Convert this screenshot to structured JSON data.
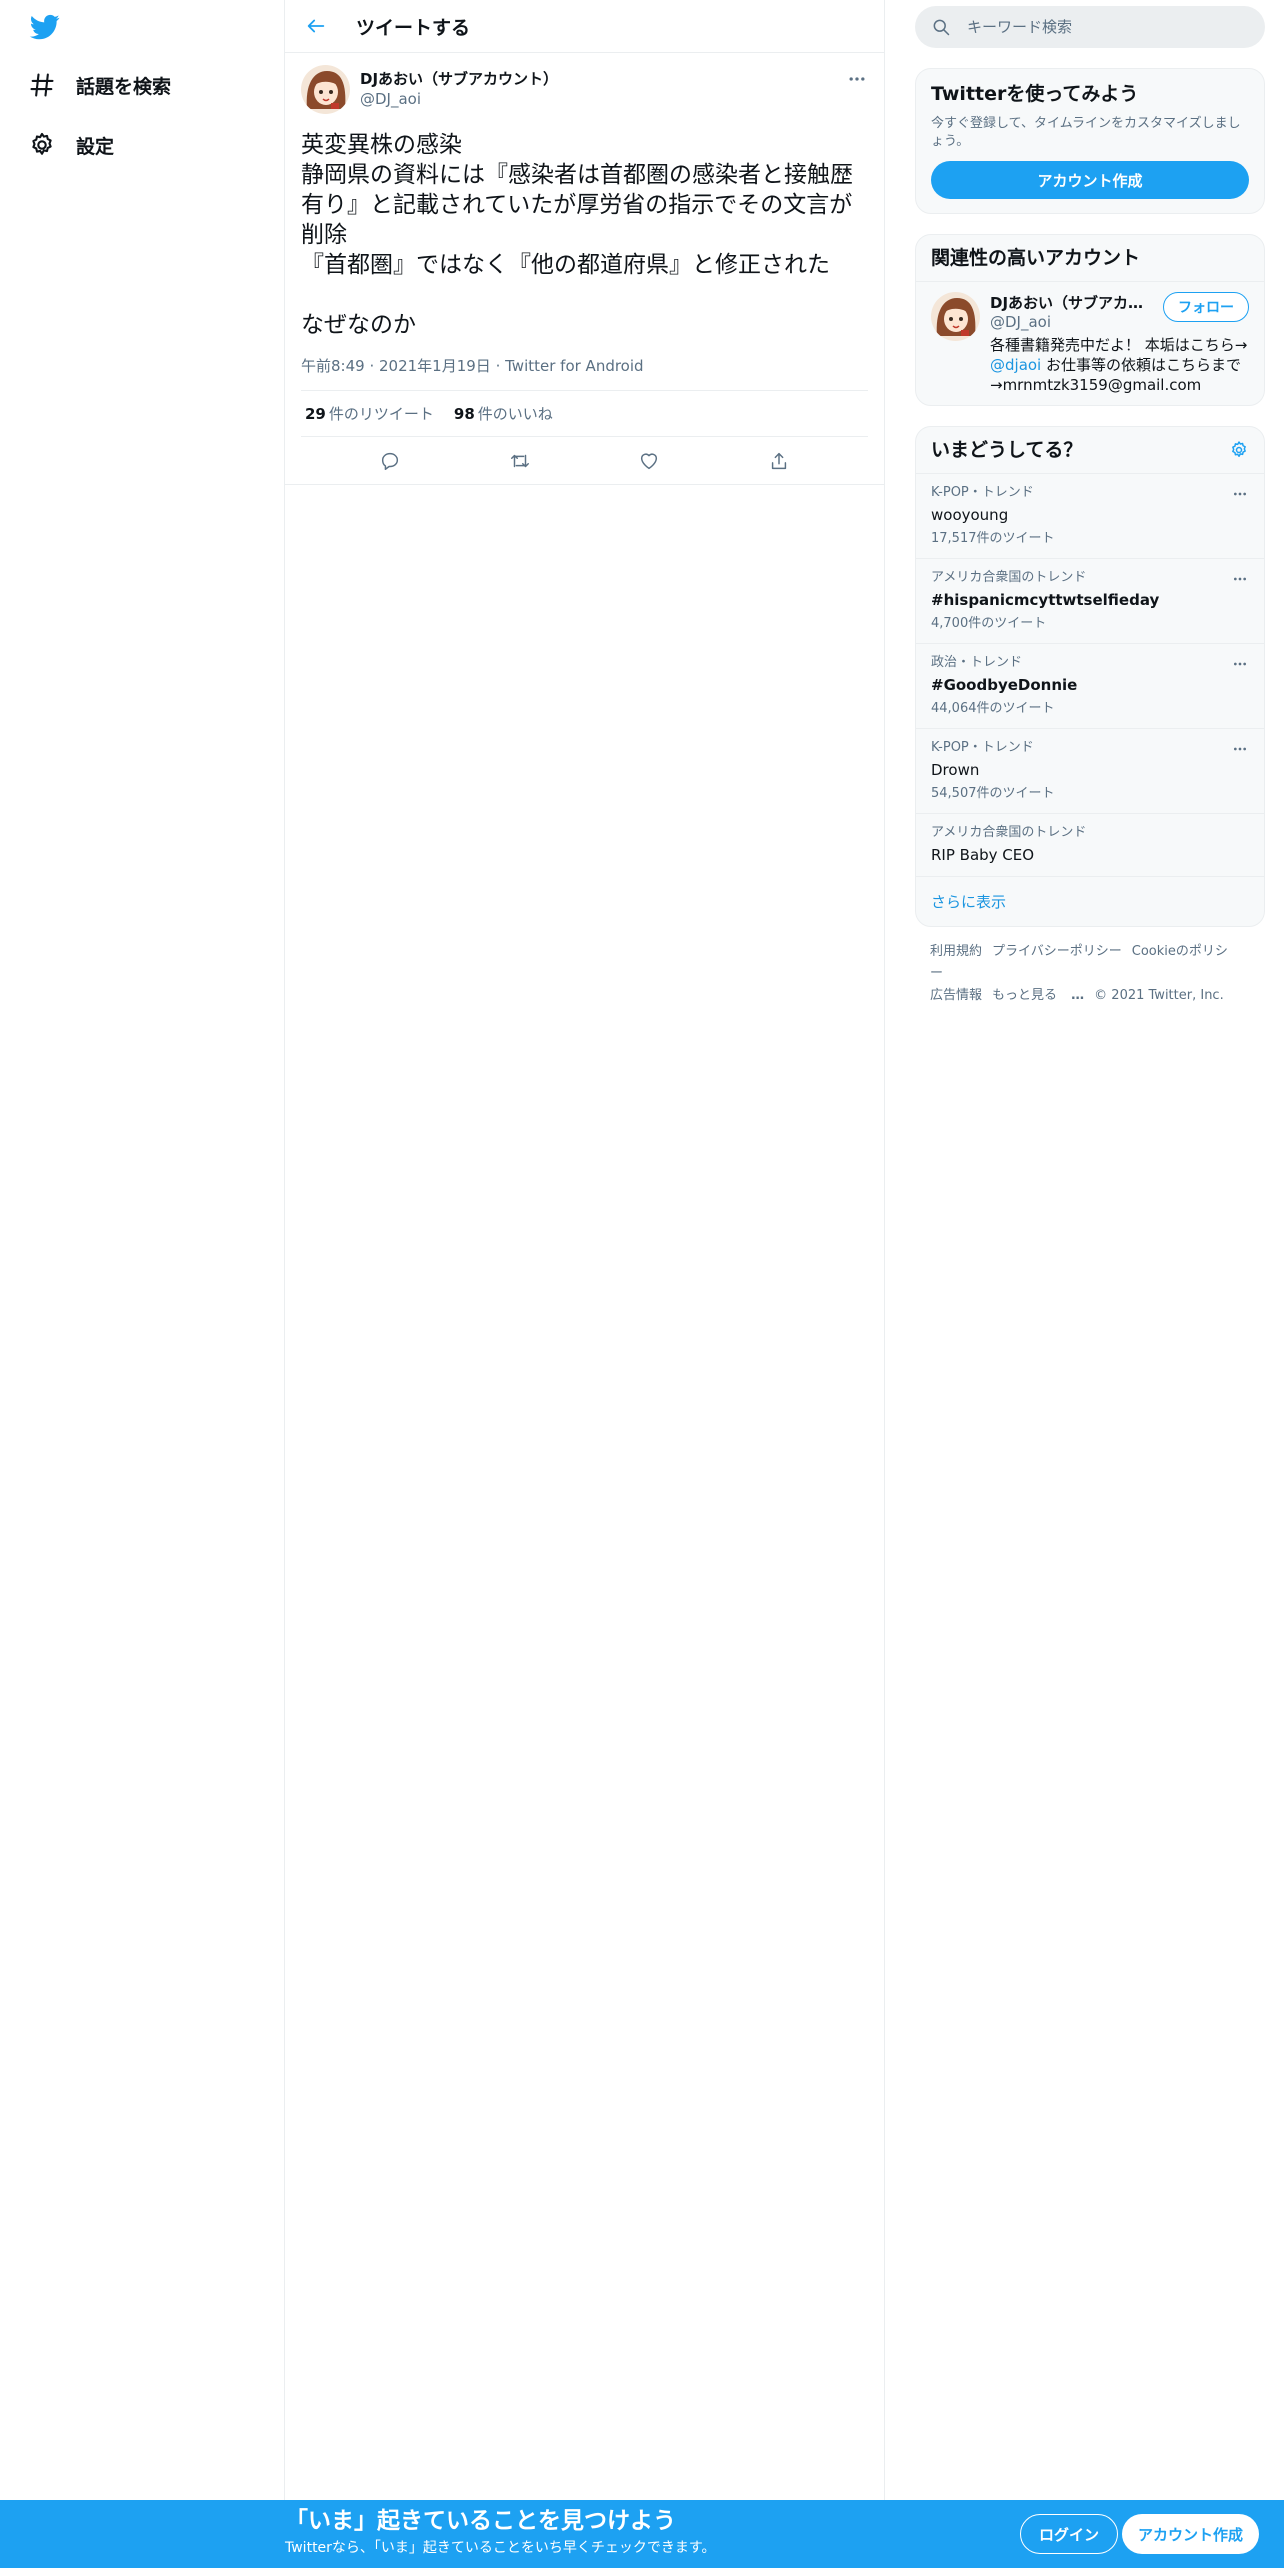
{
  "nav": {
    "explore_label": "話題を検索",
    "settings_label": "設定"
  },
  "header": {
    "title": "ツイートする"
  },
  "tweet": {
    "display_name": "DJあおい（サブアカウント）",
    "handle": "@DJ_aoi",
    "text": "英変異株の感染\n静岡県の資料には『感染者は首都圏の感染者と接触歴有り』と記載されていたが厚労省の指示でその文言が削除\n『首都圏』ではなく『他の都道府県』と修正された\n\nなぜなのか",
    "time": "午前8:49",
    "date": "2021年1月19日",
    "source": "Twitter for Android",
    "retweet_count": "29",
    "retweet_label": "件のリツイート",
    "like_count": "98",
    "like_label": "件のいいね"
  },
  "search": {
    "placeholder": "キーワード検索"
  },
  "signup_card": {
    "title": "Twitterを使ってみよう",
    "subtitle": "今すぐ登録して、タイムラインをカスタマイズしましょう。",
    "button": "アカウント作成"
  },
  "related": {
    "title": "関連性の高いアカウント",
    "name": "DJあおい（サブアカウント）",
    "handle": "@DJ_aoi",
    "follow": "フォロー",
    "bio_1": "各種書籍発売中だよ！ 本垢はこちら→ ",
    "bio_link": "@djaoi",
    "bio_2": " お仕事等の依頼はこちらまで→mrnmtzk3159@gmail.com"
  },
  "trends": {
    "title": "いまどうしてる？",
    "items": [
      {
        "context": "K-POP・トレンド",
        "name": "wooyoung",
        "count": "17,517件のツイート"
      },
      {
        "context": "アメリカ合衆国のトレンド",
        "name": "#hispanicmcyttwtselfieday",
        "count": "4,700件のツイート"
      },
      {
        "context": "政治・トレンド",
        "name": "#GoodbyeDonnie",
        "count": "44,064件のツイート"
      },
      {
        "context": "K-POP・トレンド",
        "name": "Drown",
        "count": "54,507件のツイート"
      },
      {
        "context": "アメリカ合衆国のトレンド",
        "name": "RIP Baby CEO",
        "count": ""
      }
    ],
    "show_more": "さらに表示"
  },
  "footer": {
    "terms": "利用規約",
    "privacy": "プライバシーポリシー",
    "cookie": "Cookieのポリシー",
    "ads": "広告情報",
    "more": "もっと見る",
    "copyright": "© 2021 Twitter, Inc."
  },
  "bottom_bar": {
    "title": "「いま」起きていることを見つけよう",
    "subtitle": "Twitterなら、「いま」起きていることをいち早くチェックできます。",
    "login": "ログイン",
    "signup": "アカウント作成"
  },
  "colors": {
    "brand": "#1da1f2",
    "link": "#1b95e0",
    "secondary_text": "#5b7083"
  }
}
